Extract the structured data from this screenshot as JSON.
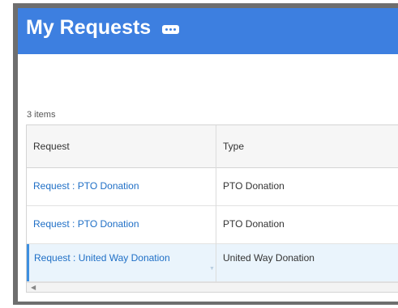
{
  "page": {
    "title": "My Requests",
    "more_icon": "ellipsis-icon",
    "items_count": "3 items"
  },
  "table": {
    "columns": [
      "Request",
      "Type"
    ],
    "rows": [
      {
        "request": "Request : PTO Donation",
        "type": "PTO Donation",
        "selected": false
      },
      {
        "request": "Request : PTO Donation",
        "type": "PTO Donation",
        "selected": false
      },
      {
        "request": "Request : United Way Donation",
        "type": "United Way Donation",
        "selected": true
      }
    ]
  },
  "icons": {
    "scroll_left": "chevron-left-icon",
    "cell_menu": "caret-down-icon"
  },
  "colors": {
    "header_bg": "#3d7fe0",
    "link": "#1f6fc6",
    "selected_row": "#eaf4fc",
    "selected_accent": "#3d8fe0"
  }
}
